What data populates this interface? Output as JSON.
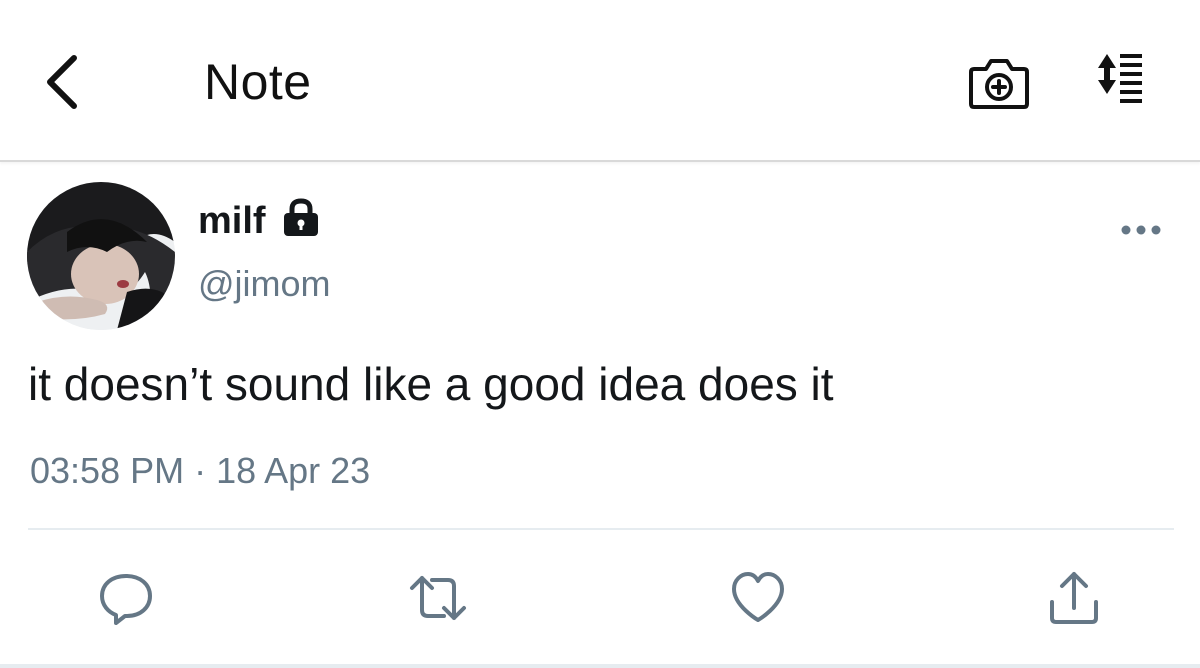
{
  "header": {
    "title": "Note",
    "icons": {
      "back": "chevron-left-icon",
      "camera": "camera-plus-icon",
      "sort": "sort-list-icon"
    }
  },
  "tweet": {
    "display_name": "milf",
    "handle": "@jimom",
    "text": "it doesn’t sound like a good idea does it",
    "timestamp": "03:58 PM · 18 Apr 23",
    "protected": true
  },
  "actions": [
    {
      "name": "reply",
      "icon": "reply-icon"
    },
    {
      "name": "retweet",
      "icon": "retweet-icon"
    },
    {
      "name": "like",
      "icon": "heart-icon"
    },
    {
      "name": "share",
      "icon": "share-icon"
    }
  ],
  "colors": {
    "text_primary": "#14171a",
    "text_secondary": "#657786",
    "icon_gray": "#657786",
    "divider": "#e6ecf0"
  }
}
